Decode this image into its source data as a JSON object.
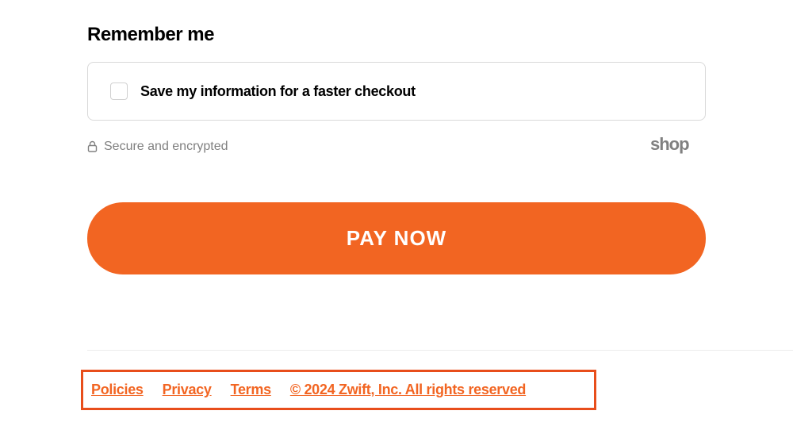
{
  "remember": {
    "heading": "Remember me",
    "checkbox_label": "Save my information for a faster checkout"
  },
  "secure": {
    "text": "Secure and encrypted",
    "brand": "shop"
  },
  "pay_button": {
    "label": "PAY NOW"
  },
  "footer": {
    "policies": "Policies",
    "privacy": "Privacy",
    "terms": "Terms",
    "copyright": "© 2024 Zwift, Inc. All rights reserved"
  },
  "colors": {
    "accent": "#f26522",
    "text_muted": "#808080",
    "border": "#d9d9d9"
  }
}
